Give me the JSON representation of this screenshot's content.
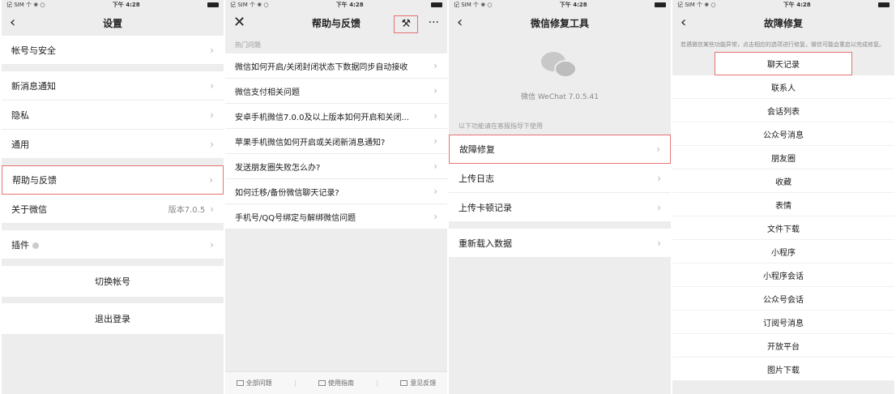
{
  "status": {
    "left": "记 SIM 个 ❀ ○",
    "time": "下午 4:28"
  },
  "screen1": {
    "title": "设置",
    "rows": [
      {
        "label": "帐号与安全"
      },
      {
        "label": "新消息通知"
      },
      {
        "label": "隐私"
      },
      {
        "label": "通用"
      },
      {
        "label": "帮助与反馈"
      },
      {
        "label": "关于微信",
        "value": "版本7.0.5"
      },
      {
        "label": "插件"
      }
    ],
    "switch_account": "切换帐号",
    "logout": "退出登录"
  },
  "screen2": {
    "title": "帮助与反馈",
    "tool_icon": "⚒",
    "section": "热门问题",
    "questions": [
      "微信如何开启/关闭封闭状态下数据同步自动接收",
      "微信支付相关问题",
      "安卓手机微信7.0.0及以上版本如何开启和关闭...",
      "苹果手机微信如何开启或关闭新消息通知?",
      "发送朋友圈失败怎么办?",
      "如何迁移/备份微信聊天记录?",
      "手机号/QQ号绑定与解绑微信问题"
    ],
    "bottom": [
      "全部问题",
      "使用指南",
      "意见反馈"
    ]
  },
  "screen3": {
    "title": "微信修复工具",
    "version": "微信 WeChat 7.0.5.41",
    "section": "以下功能请在客服指导下使用",
    "rows": [
      "故障修复",
      "上传日志",
      "上传卡顿记录"
    ],
    "reload": "重新载入数据"
  },
  "screen4": {
    "title": "故障修复",
    "description": "若遇微信某些功能异常，点击相应的选项进行修复，微信可能会重启以完成修复。",
    "items": [
      "聊天记录",
      "联系人",
      "会话列表",
      "公众号消息",
      "朋友圈",
      "收藏",
      "表情",
      "文件下载",
      "小程序",
      "小程序会话",
      "公众号会话",
      "订阅号消息",
      "开放平台",
      "图片下载"
    ]
  },
  "colors": {
    "highlight": "#e57373",
    "background": "#ededed"
  }
}
